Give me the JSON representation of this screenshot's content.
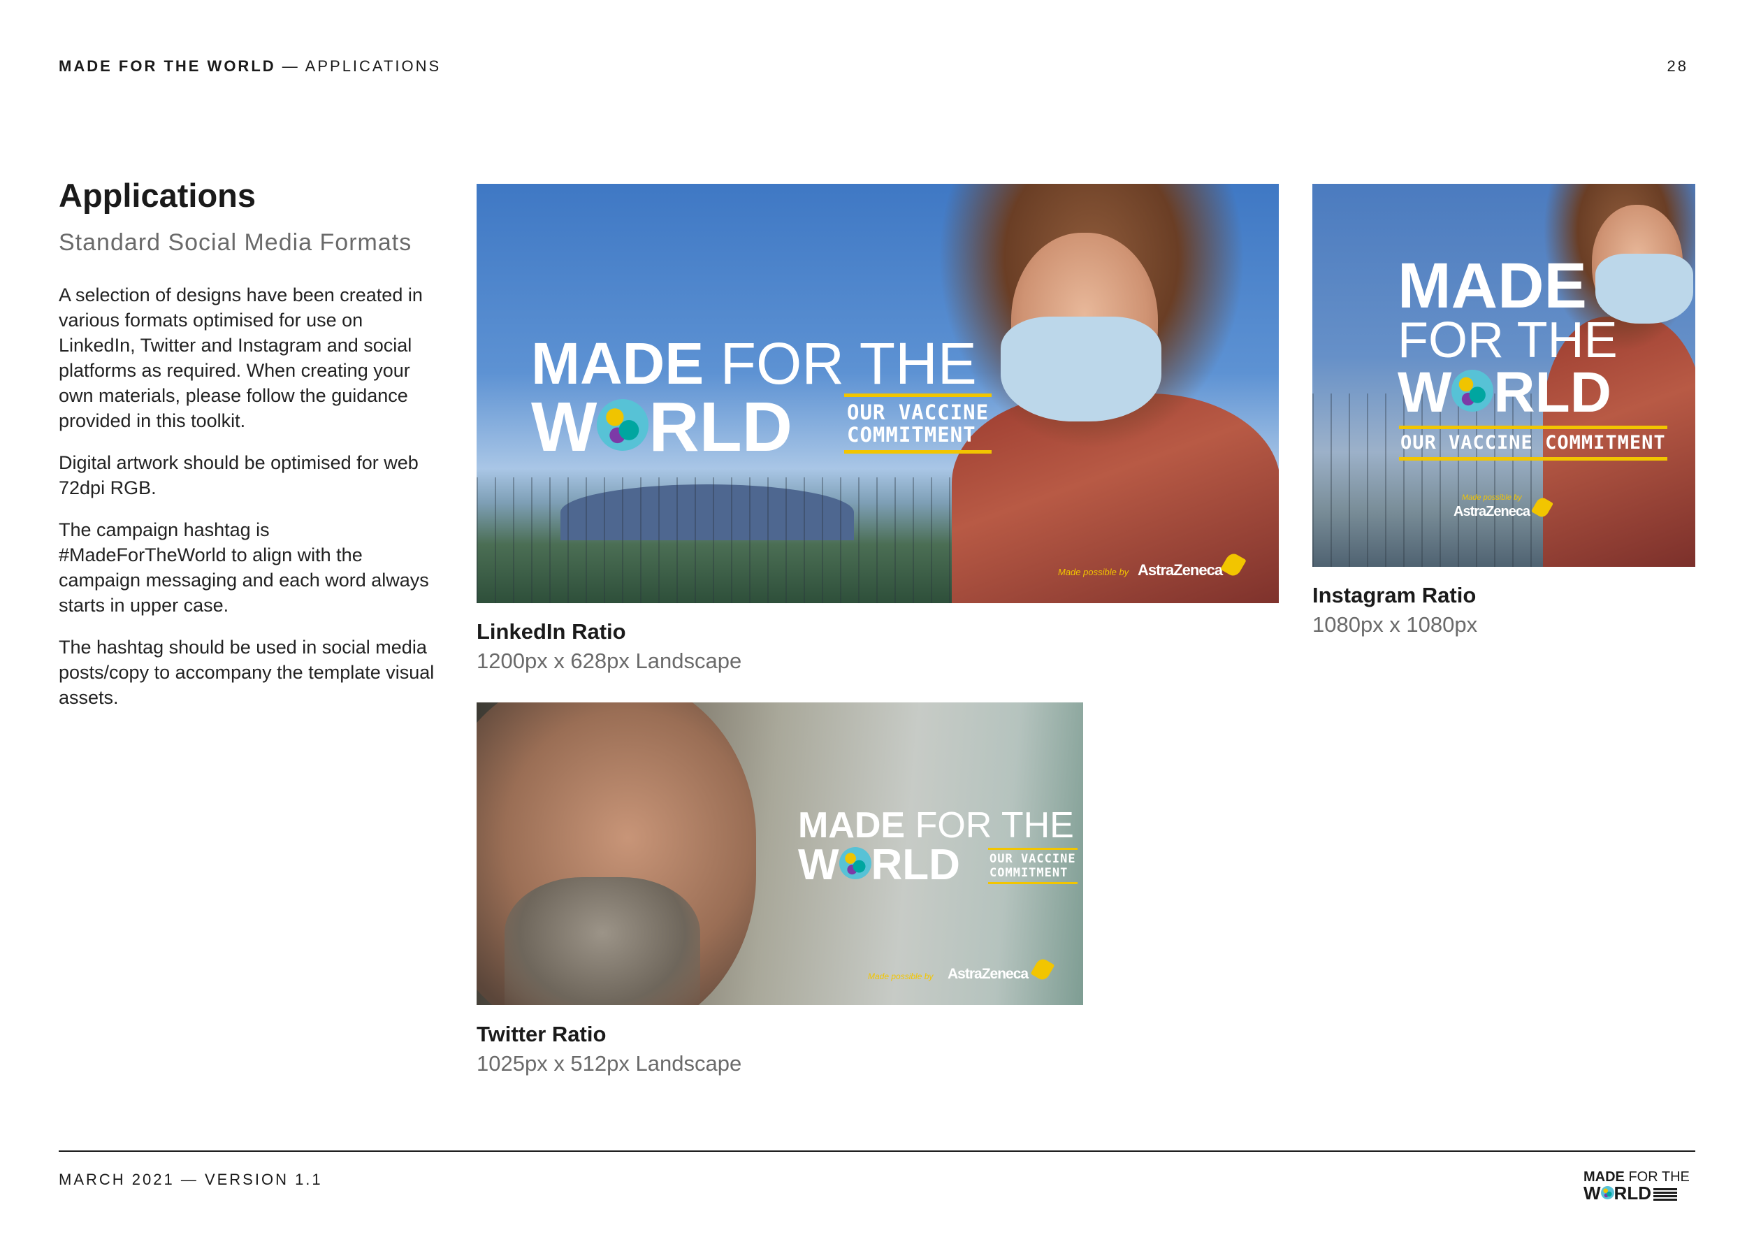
{
  "header": {
    "title_bold": "MADE FOR THE WORLD",
    "title_rest": " — APPLICATIONS",
    "page_number": "28"
  },
  "left": {
    "title": "Applications",
    "subtitle": "Standard Social Media Formats",
    "paragraphs": [
      "A selection of designs have been created in various formats optimised for use on LinkedIn, Twitter and Instagram and social platforms as required. When creating your own materials, please follow the guidance provided in this toolkit.",
      "Digital artwork should be optimised for web 72dpi RGB.",
      "The campaign hashtag is #MadeForTheWorld to align with the campaign messaging and each word always starts in upper case.",
      "The hashtag should be used in social media posts/copy to accompany the template visual assets."
    ]
  },
  "logo": {
    "made": "MADE",
    "for_the": "FOR THE",
    "w": "W",
    "rld": "RLD",
    "tag_line1": "OUR VACCINE",
    "tag_line2": "COMMITMENT",
    "tag_full": "OUR VACCINE COMMITMENT",
    "made_possible_by": "Made possible by",
    "astrazeneca": "AstraZeneca"
  },
  "tiles": {
    "linkedin": {
      "caption_title": "LinkedIn Ratio",
      "caption_size": "1200px x 628px Landscape"
    },
    "instagram": {
      "caption_title": "Instagram Ratio",
      "caption_size": "1080px x 1080px"
    },
    "twitter": {
      "caption_title": "Twitter Ratio",
      "caption_size": "1025px x 512px Landscape"
    }
  },
  "footer": {
    "text": "MARCH 2021 — VERSION 1.1"
  },
  "colors": {
    "accent_yellow": "#f2c500",
    "text_dark": "#1a1a1a",
    "text_grey": "#6a6a6a"
  }
}
